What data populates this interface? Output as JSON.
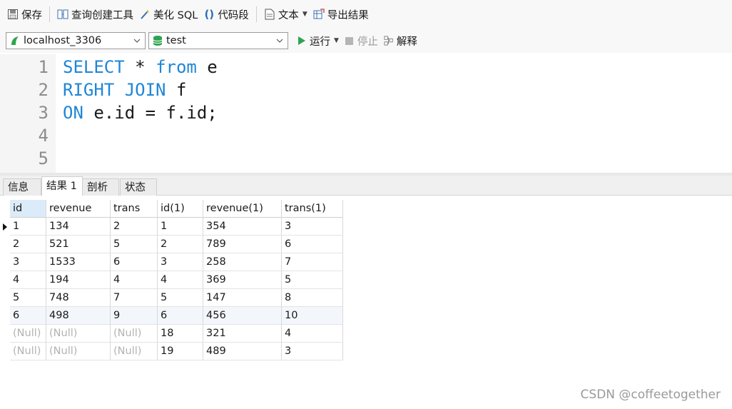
{
  "toolbar": {
    "save": "保存",
    "query_builder": "查询创建工具",
    "beautify_sql": "美化 SQL",
    "code_snippet": "代码段",
    "text": "文本",
    "export_results": "导出结果"
  },
  "connection": {
    "server": "localhost_3306",
    "database": "test",
    "run": "运行",
    "stop": "停止",
    "explain": "解释"
  },
  "editor": {
    "line_numbers": [
      "1",
      "2",
      "3",
      "4",
      "5"
    ],
    "lines": [
      [
        {
          "t": "SELECT",
          "kw": true
        },
        {
          "t": " * ",
          "kw": false
        },
        {
          "t": "from",
          "kw": true
        },
        {
          "t": " e",
          "kw": false
        }
      ],
      [
        {
          "t": "RIGHT",
          "kw": true
        },
        {
          "t": " ",
          "kw": false
        },
        {
          "t": "JOIN",
          "kw": true
        },
        {
          "t": " f",
          "kw": false
        }
      ],
      [
        {
          "t": "ON",
          "kw": true
        },
        {
          "t": " e.id = f.id;",
          "kw": false
        }
      ],
      [],
      []
    ],
    "keyword_color": "#1f86d6"
  },
  "tabs": [
    {
      "label": "信息",
      "active": false
    },
    {
      "label": "结果 1",
      "active": true
    },
    {
      "label": "剖析",
      "active": false
    },
    {
      "label": "状态",
      "active": false
    }
  ],
  "results": {
    "columns": [
      "id",
      "revenue",
      "trans",
      "id(1)",
      "revenue(1)",
      "trans(1)"
    ],
    "rows": [
      [
        "1",
        "134",
        "2",
        "1",
        "354",
        "3"
      ],
      [
        "2",
        "521",
        "5",
        "2",
        "789",
        "6"
      ],
      [
        "3",
        "1533",
        "6",
        "3",
        "258",
        "7"
      ],
      [
        "4",
        "194",
        "4",
        "4",
        "369",
        "5"
      ],
      [
        "5",
        "748",
        "7",
        "5",
        "147",
        "8"
      ],
      [
        "6",
        "498",
        "9",
        "6",
        "456",
        "10"
      ],
      [
        "(Null)",
        "(Null)",
        "(Null)",
        "18",
        "321",
        "4"
      ],
      [
        "(Null)",
        "(Null)",
        "(Null)",
        "19",
        "489",
        "3"
      ]
    ],
    "current_row": 0,
    "highlighted_row": 5
  },
  "watermark": "CSDN @coffeetogether"
}
